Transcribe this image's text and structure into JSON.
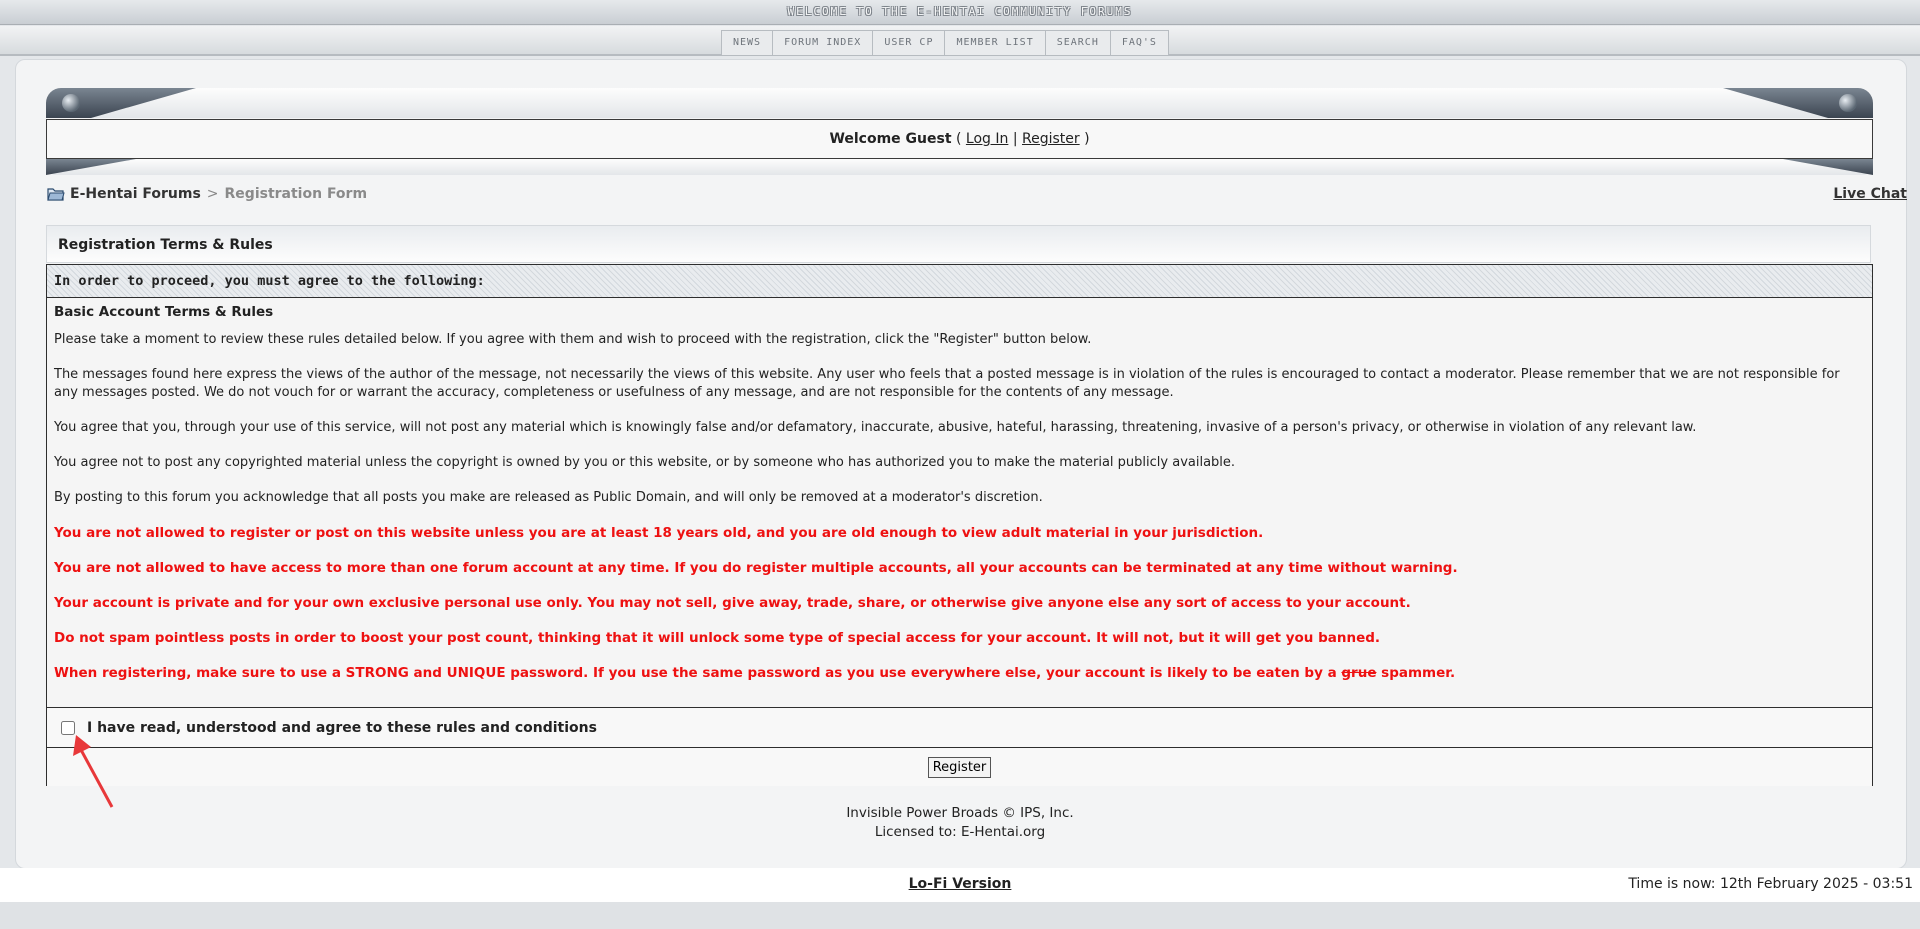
{
  "banner": {
    "text": "WELCOME TO THE E-HENTAI COMMUNITY FORUMS"
  },
  "nav": {
    "items": [
      "NEWS",
      "FORUM INDEX",
      "USER CP",
      "MEMBER LIST",
      "SEARCH",
      "FAQ'S"
    ]
  },
  "welcome": {
    "greeting": "Welcome Guest",
    "open_paren": "(",
    "login": "Log In",
    "sep": "|",
    "register": "Register",
    "close_paren": ")"
  },
  "breadcrumb": {
    "home": "E-Hentai Forums",
    "sep": ">",
    "current": "Registration Form"
  },
  "live_chat": "Live Chat",
  "registration": {
    "title": "Registration Terms & Rules",
    "subhead": "In order to proceed, you must agree to the following:",
    "terms_title": "Basic Account Terms & Rules",
    "paragraphs": [
      "Please take a moment to review these rules detailed below. If you agree with them and wish to proceed with the registration, click the \"Register\" button below.",
      "The messages found here express the views of the author of the message, not necessarily the views of this website. Any user who feels that a posted message is in violation of the rules is encouraged to contact a moderator. Please remember that we are not responsible for any messages posted. We do not vouch for or warrant the accuracy, completeness or usefulness of any message, and are not responsible for the contents of any message.",
      "You agree that you, through your use of this service, will not post any material which is knowingly false and/or defamatory, inaccurate, abusive, hateful, harassing, threatening, invasive of a person's privacy, or otherwise in violation of any relevant law.",
      "You agree not to post any copyrighted material unless the copyright is owned by you or this website, or by someone who has authorized you to make the material publicly available.",
      "By posting to this forum you acknowledge that all posts you make are released as Public Domain, and will only be removed at a moderator's discretion."
    ],
    "red_rules": [
      "You are not allowed to register or post on this website unless you are at least 18 years old, and you are old enough to view adult material in your jurisdiction.",
      "You are not allowed to have access to more than one forum account at any time. If you do register multiple accounts, all your accounts can be terminated at any time without warning.",
      "Your account is private and for your own exclusive personal use only. You may not sell, give away, trade, share, or otherwise give anyone else any sort of access to your account.",
      "Do not spam pointless posts in order to boost your post count, thinking that it will unlock some type of special access for your account. It will not, but it will get you banned."
    ],
    "last_rule": {
      "before": "When registering, make sure to use a STRONG and UNIQUE password. If you use the same password as you use everywhere else, your account is likely to be eaten by a ",
      "struck": "grue",
      "after": " spammer."
    },
    "agree_label": "I have read, understood and agree to these rules and conditions",
    "agree_checked": false,
    "register_button": "Register"
  },
  "footer": {
    "line1": "Invisible Power Broads © IPS, Inc.",
    "line2": "Licensed to: E-Hentai.org",
    "lofi": "Lo-Fi Version",
    "time": "Time is now: 12th February 2025 - 03:51"
  },
  "colors": {
    "rule_red": "#ee1111",
    "arrow_red": "#e8383a"
  }
}
